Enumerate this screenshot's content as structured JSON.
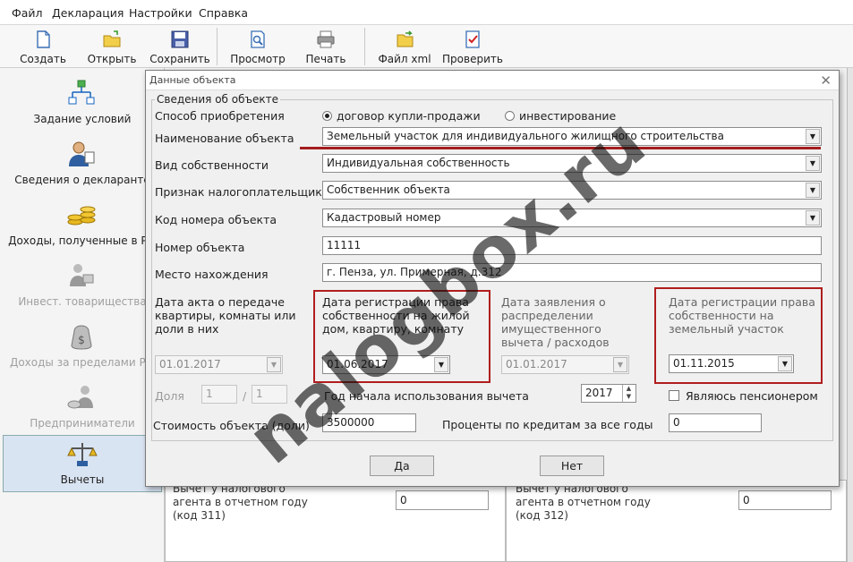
{
  "menu": [
    "Файл",
    "Декларация",
    "Настройки",
    "Справка"
  ],
  "toolbar": {
    "create": "Создать",
    "open": "Открыть",
    "save": "Сохранить",
    "preview": "Просмотр",
    "print": "Печать",
    "xml": "Файл xml",
    "check": "Проверить"
  },
  "sidebar": [
    {
      "label": "Задание условий",
      "icon": "conditions-icon"
    },
    {
      "label": "Сведения о декларанте",
      "icon": "declarant-icon"
    },
    {
      "label": "Доходы, полученные в РФ",
      "icon": "income-rf-icon"
    },
    {
      "label": "Инвест. товарищества",
      "icon": "investment-icon"
    },
    {
      "label": "Доходы за пределами РФ",
      "icon": "foreign-income-icon"
    },
    {
      "label": "Предприниматели",
      "icon": "entrepreneur-icon"
    },
    {
      "label": "Вычеты",
      "icon": "deductions-icon"
    }
  ],
  "background": {
    "agent_left": "Вычет у налогового агента в отчетном году (код 311)",
    "agent_left_value": "0",
    "agent_right": "Вычет у налогового агента в отчетном году (код 312)",
    "agent_right_value": "0"
  },
  "dialog": {
    "title": "Данные объекта",
    "group": "Сведения об объекте",
    "acq_label": "Способ приобретения",
    "acq_option1": "договор купли-продажи",
    "acq_option2": "инвестирование",
    "name_label": "Наименование объекта",
    "name_value": "Земельный участок для индивидуального жилищного строительства",
    "ownership_label": "Вид собственности",
    "ownership_value": "Индивидуальная собственность",
    "payer_label": "Признак налогоплательщика",
    "payer_value": "Собственник объекта",
    "code_label": "Код номера объекта",
    "code_value": "Кадастровый номер",
    "number_label": "Номер объекта",
    "number_value": "11111",
    "location_label": "Место нахождения",
    "location_value": "г. Пенза, ул. Примерная, д.312",
    "date_act_label": "Дата акта о передаче квартиры, комнаты или доли в них",
    "date_act_value": "01.01.2017",
    "date_reg_home_label": "Дата регистрации права собственности на жилой дом, квартиру, комнату",
    "date_reg_home_value": "01.06.2017",
    "date_app_label": "Дата заявления о распределении имущественного вычета / расходов",
    "date_app_value": "01.01.2017",
    "date_reg_land_label": "Дата регистрации права собственности на земельный участок",
    "date_reg_land_value": "01.11.2015",
    "share_label": "Доля",
    "share_num": "1",
    "share_sep": "/",
    "share_den": "1",
    "year_label": "Год начала использования вычета",
    "year_value": "2017",
    "pensioner_label": "Являюсь пенсионером",
    "cost_label": "Стоимость объекта (доли)",
    "cost_value": "3500000",
    "credit_label": "Проценты по кредитам за все годы",
    "credit_value": "0",
    "yes": "Да",
    "no": "Нет"
  },
  "watermark": "nalogbox.ru",
  "colors": {
    "highlight": "#b01e1e"
  }
}
